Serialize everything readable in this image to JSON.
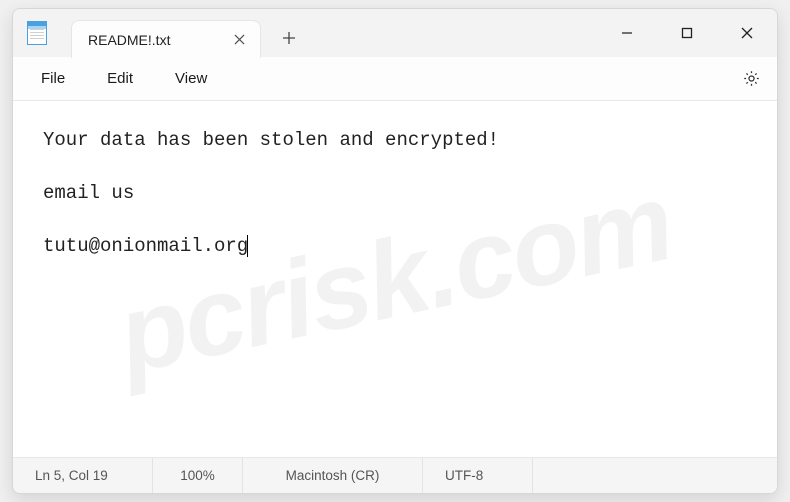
{
  "tab": {
    "title": "README!.txt"
  },
  "menu": {
    "file": "File",
    "edit": "Edit",
    "view": "View"
  },
  "content": {
    "line1": "Your data has been stolen and encrypted!",
    "line2": "email us",
    "line3": "tutu@onionmail.org"
  },
  "status": {
    "position": "Ln 5, Col 19",
    "zoom": "100%",
    "line_ending": "Macintosh (CR)",
    "encoding": "UTF-8"
  },
  "watermark": "pcrisk.com"
}
